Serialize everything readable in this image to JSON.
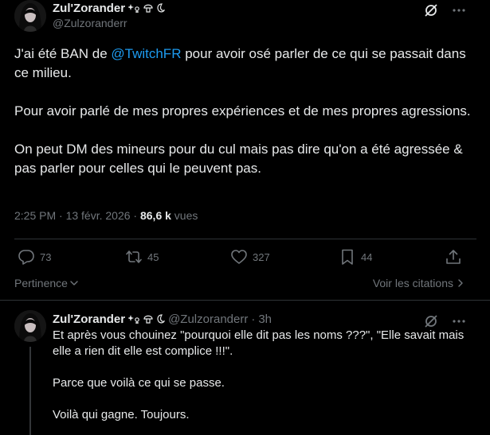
{
  "main_tweet": {
    "author": {
      "display_name": "Zul'Zorander",
      "emoji_badges": [
        "sparkle-flower",
        "mushroom",
        "crescent-moon"
      ],
      "handle": "@Zulzoranderr"
    },
    "text_before_mention": "J'ai été BAN de ",
    "mention": "@TwitchFR",
    "text_after_mention": " pour avoir osé parler de ce qui se passait dans ce milieu.",
    "paragraph_2": "Pour avoir parlé de mes propres expériences et de mes propres agressions.",
    "paragraph_3": "On peut DM des mineurs pour du cul mais pas dire qu'on a été agressée & pas parler pour celles qui le peuvent pas.",
    "timestamp": "2:25 PM · 13 févr. 2026 · ",
    "views_count": "86,6 k",
    "views_label": " vues",
    "actions": {
      "replies": "73",
      "reposts": "45",
      "likes": "327",
      "bookmarks": "44"
    }
  },
  "sort": {
    "label": "Pertinence",
    "quotes_link": "Voir les citations"
  },
  "reply": {
    "author": {
      "display_name": "Zul'Zorander",
      "handle": "@Zulzoranderr",
      "separator": "·",
      "time": "3h"
    },
    "paragraph_1": "Et après vous chouinez \"pourquoi elle dit pas les noms ???\", \"Elle savait mais elle a rien dit elle est complice !!!\".",
    "paragraph_2": "Parce que voilà ce qui se passe.",
    "paragraph_3": "Voilà qui gagne. Toujours."
  },
  "colors": {
    "background": "#000000",
    "text_primary": "#e7e9ea",
    "text_secondary": "#71767b",
    "link": "#1d9bf0",
    "border": "#2f3336"
  },
  "icons": {
    "grok": "grok-slash-circle-icon",
    "more": "more-dots-icon",
    "reply": "reply-bubble-icon",
    "repost": "repost-arrows-icon",
    "like": "heart-icon",
    "bookmark": "bookmark-icon",
    "share": "share-upload-icon",
    "chevron_down": "chevron-down-icon",
    "chevron_right": "chevron-right-icon"
  }
}
